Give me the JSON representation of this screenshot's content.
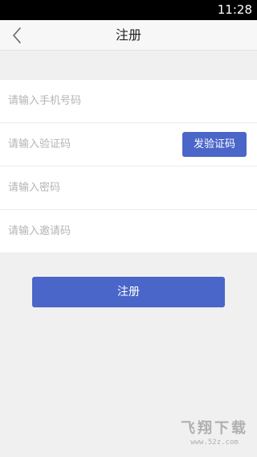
{
  "status_bar": {
    "time": "11:28"
  },
  "header": {
    "back_icon": "chevron-left-icon",
    "title": "注册"
  },
  "form": {
    "phone": {
      "value": "",
      "placeholder": "请输入手机号码"
    },
    "code": {
      "value": "",
      "placeholder": "请输入验证码",
      "send_button_label": "发验证码"
    },
    "password": {
      "value": "",
      "placeholder": "请输入密码"
    },
    "invite": {
      "value": "",
      "placeholder": "请输入邀请码"
    }
  },
  "submit": {
    "label": "注册"
  },
  "watermark": {
    "line1": "飞翔下载",
    "line2": "www.52z.com"
  },
  "colors": {
    "accent": "#4a66c8",
    "status_bar": "#000000",
    "background": "#f0f0f0"
  }
}
